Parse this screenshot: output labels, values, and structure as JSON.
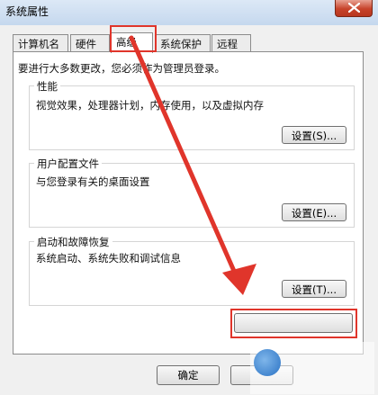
{
  "window": {
    "title": "系统属性"
  },
  "tabs": [
    {
      "label": "计算机名",
      "active": false
    },
    {
      "label": "硬件",
      "active": false
    },
    {
      "label": "高级",
      "active": true
    },
    {
      "label": "系统保护",
      "active": false
    },
    {
      "label": "远程",
      "active": false
    }
  ],
  "admin_note": "要进行大多数更改，您必须作为管理员登录。",
  "performance": {
    "title": "性能",
    "desc": "视觉效果，处理器计划，内存使用，以及虚拟内存",
    "button": "设置(S)..."
  },
  "user_profiles": {
    "title": "用户配置文件",
    "desc": "与您登录有关的桌面设置",
    "button": "设置(E)..."
  },
  "startup_recovery": {
    "title": "启动和故障恢复",
    "desc": "系统启动、系统失败和调试信息",
    "button": "设置(T)..."
  },
  "footer": {
    "ok": "确定"
  },
  "annotation": {
    "color": "#e0352b"
  }
}
